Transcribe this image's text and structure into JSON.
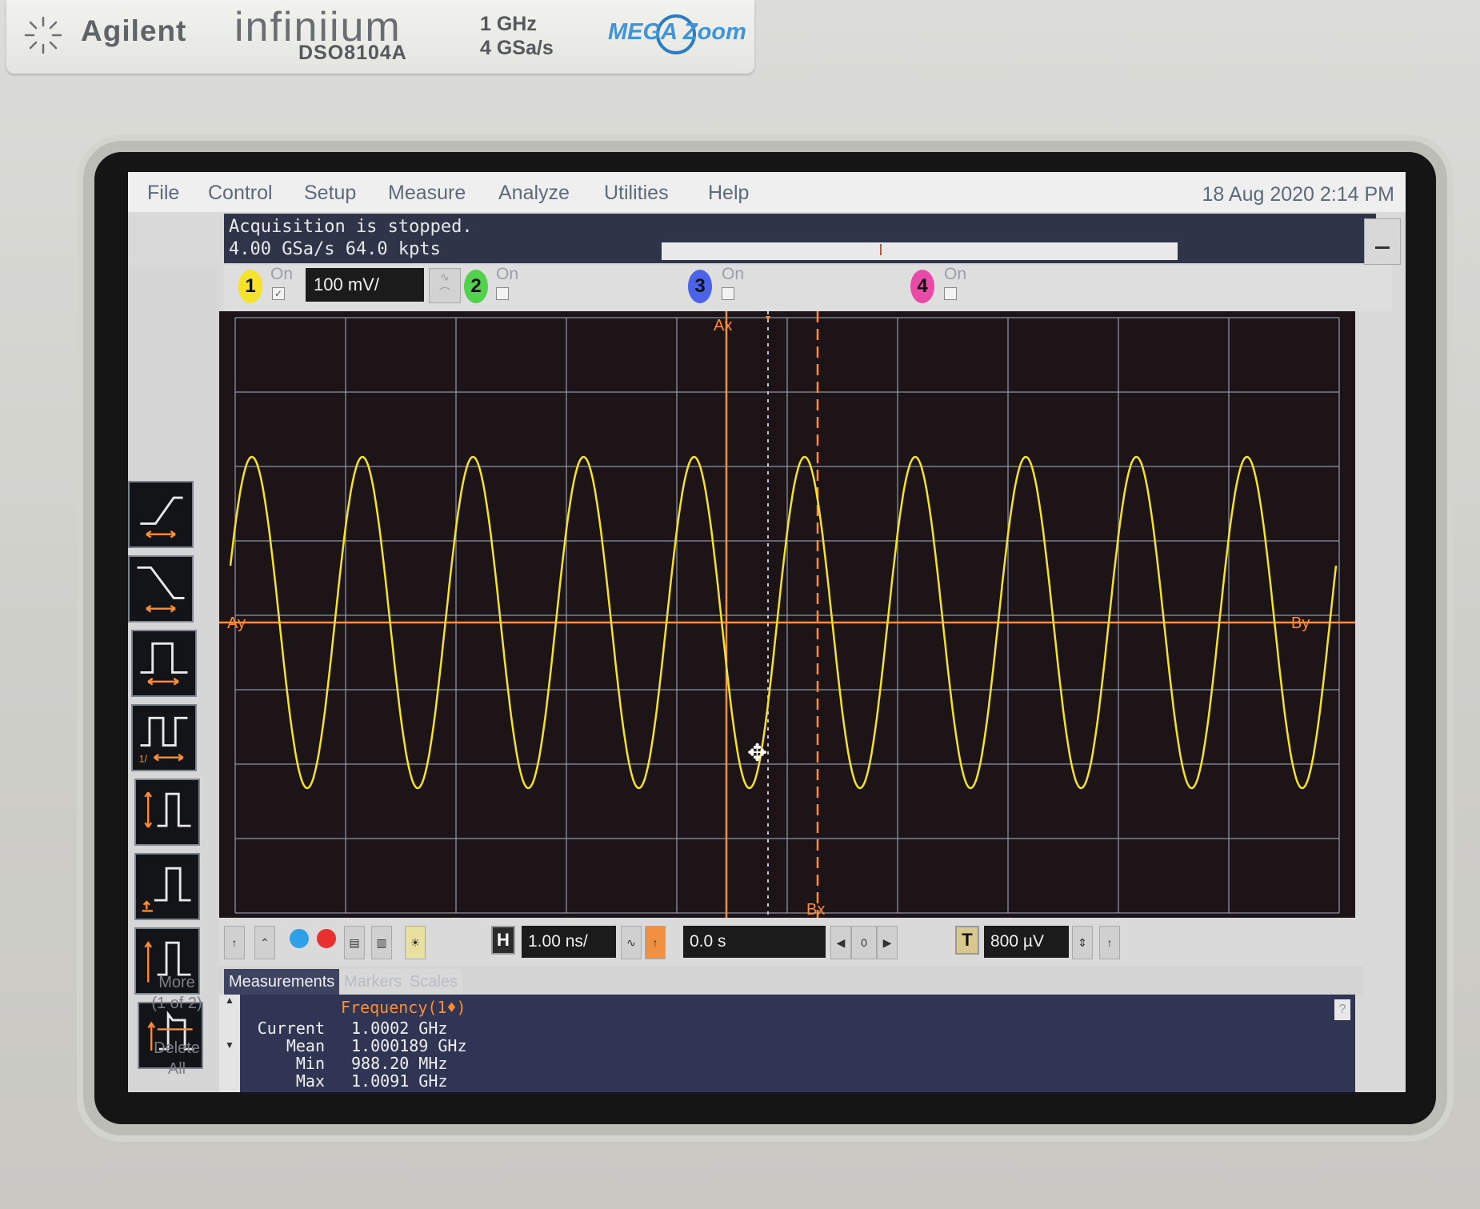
{
  "branding": {
    "maker": "Agilent",
    "series": "infiniium",
    "model": "DSO8104A",
    "bandwidth": "1 GHz",
    "sample_rate": "4 GSa/s",
    "feature_logo": "MEGA Zoom"
  },
  "menu": {
    "items": [
      "File",
      "Control",
      "Setup",
      "Measure",
      "Analyze",
      "Utilities",
      "Help"
    ],
    "datetime": "18 Aug 2020  2:14 PM"
  },
  "status": {
    "line1": "Acquisition is stopped.",
    "line2": "4.00 GSa/s   64.0 kpts"
  },
  "channels": {
    "ch1": {
      "number": "1",
      "on_label": "On",
      "checked": true,
      "scale": "100 mV/",
      "color": "#f5e22a"
    },
    "ch2": {
      "number": "2",
      "on_label": "On",
      "checked": false,
      "color": "#52d24c"
    },
    "ch3": {
      "number": "3",
      "on_label": "On",
      "checked": false,
      "color": "#4a63e8"
    },
    "ch4": {
      "number": "4",
      "on_label": "On",
      "checked": false,
      "color": "#e84aa8"
    }
  },
  "toolbar": {
    "tools": [
      "rising-edge-trigger-icon",
      "falling-edge-trigger-icon",
      "pulse-width-icon",
      "period-icon",
      "amplitude-icon",
      "base-level-icon",
      "top-level-icon",
      "overshoot-icon"
    ],
    "more_label": "More\n(1 of 2)",
    "delete_label": "Delete\nAll"
  },
  "waveform": {
    "trace_color": "#f5e22a",
    "cursor_color": "#ff8c32",
    "frequency_ghz": 1.0,
    "cycles_visible": 10,
    "cursor_labels": {
      "ax": "Ax",
      "bx": "Bx",
      "ay": "Ay",
      "by": "By"
    },
    "grid_divisions_x": 10,
    "grid_divisions_y": 8
  },
  "horizontal": {
    "h_label": "H",
    "timebase": "1.00 ns/",
    "delay": "0.0 s",
    "zoom_value": "0",
    "t_label": "T",
    "trigger_level": "800 µV"
  },
  "tabs": [
    "Measurements",
    "Markers",
    "Scales"
  ],
  "measurements": {
    "header": "Frequency(1♦)",
    "rows": [
      {
        "label": "Current",
        "value": "1.0002 GHz"
      },
      {
        "label": "Mean",
        "value": "1.000189 GHz"
      },
      {
        "label": "Min",
        "value": "988.20 MHz"
      },
      {
        "label": "Max",
        "value": "1.0091 GHz"
      }
    ],
    "help": "?"
  }
}
